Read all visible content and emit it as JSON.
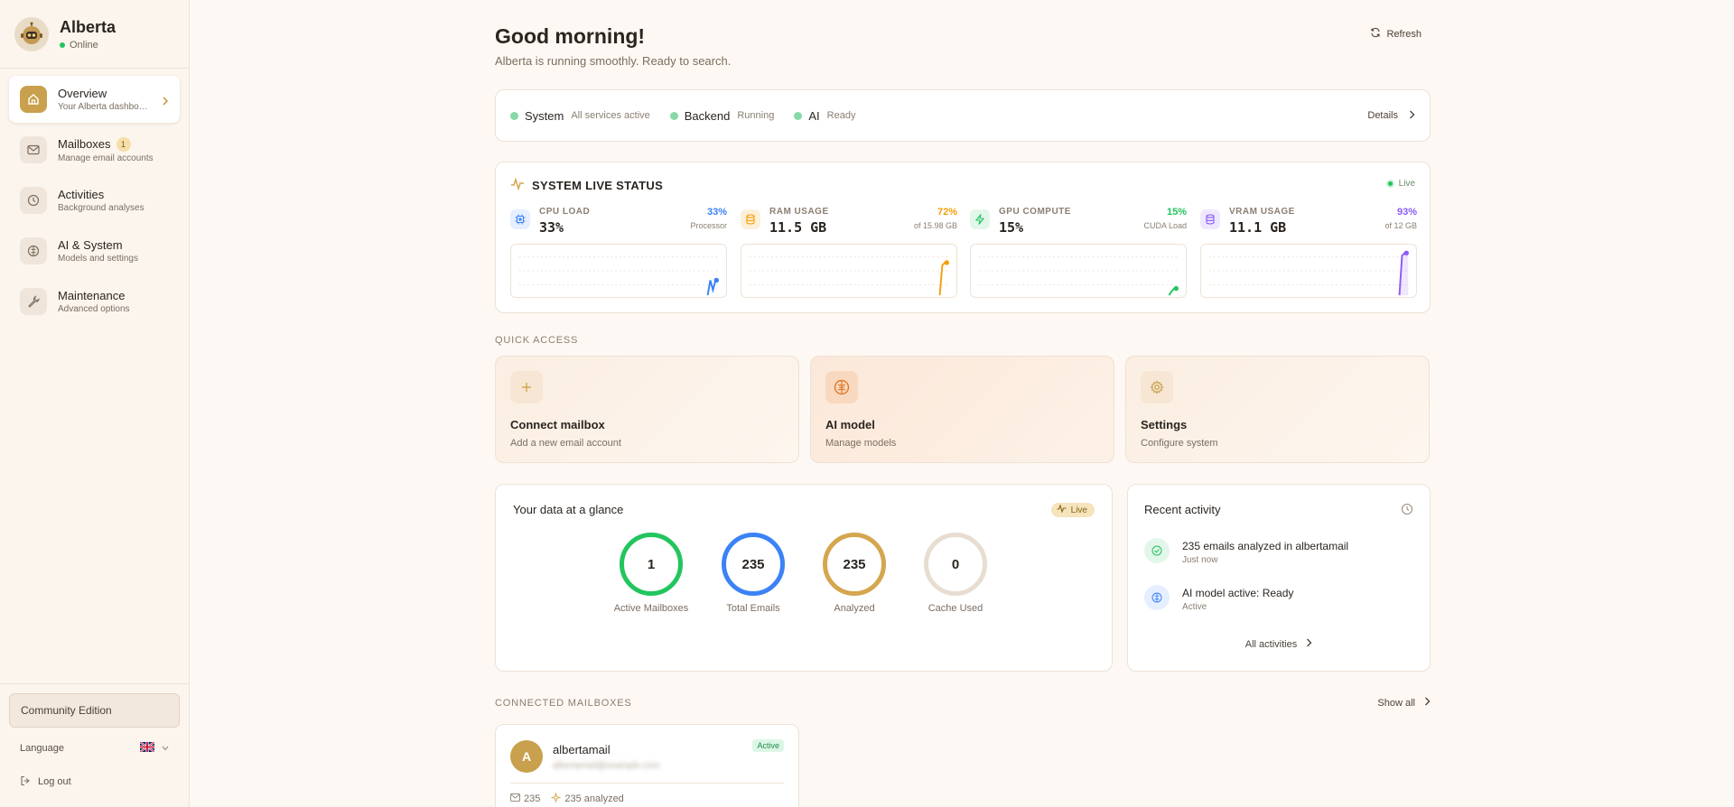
{
  "app": {
    "name": "Alberta",
    "status": "Online"
  },
  "sidebar": {
    "items": [
      {
        "label": "Overview",
        "sub": "Your Alberta dashboard",
        "icon": "home-icon"
      },
      {
        "label": "Mailboxes",
        "sub": "Manage email accounts",
        "icon": "mail-icon",
        "badge": "1"
      },
      {
        "label": "Activities",
        "sub": "Background analyses",
        "icon": "clock-icon"
      },
      {
        "label": "AI & System",
        "sub": "Models and settings",
        "icon": "brain-icon"
      },
      {
        "label": "Maintenance",
        "sub": "Advanced options",
        "icon": "wrench-icon"
      }
    ],
    "edition": "Community Edition",
    "language_label": "Language",
    "logout_label": "Log out"
  },
  "header": {
    "greeting": "Good morning!",
    "subtitle": "Alberta is running smoothly. Ready to search.",
    "refresh_label": "Refresh"
  },
  "status_bar": {
    "items": [
      {
        "name": "System",
        "value": "All services active"
      },
      {
        "name": "Backend",
        "value": "Running"
      },
      {
        "name": "AI",
        "value": "Ready"
      }
    ],
    "details_label": "Details"
  },
  "live_status": {
    "title": "SYSTEM LIVE STATUS",
    "live_label": "Live",
    "metrics": [
      {
        "name": "CPU LOAD",
        "value": "33%",
        "pct": "33%",
        "note": "Processor",
        "color": "#3b82f6",
        "icon_bg": "#e6efff",
        "level": 0.33
      },
      {
        "name": "RAM USAGE",
        "value": "11.5 GB",
        "pct": "72%",
        "note": "of 15.98 GB",
        "color": "#f59e0b",
        "icon_bg": "#fdf0d9",
        "level": 0.72
      },
      {
        "name": "GPU COMPUTE",
        "value": "15%",
        "pct": "15%",
        "note": "CUDA Load",
        "color": "#22c55e",
        "icon_bg": "#e2f7ea",
        "level": 0.15
      },
      {
        "name": "VRAM USAGE",
        "value": "11.1 GB",
        "pct": "93%",
        "note": "of 12 GB",
        "color": "#8b5cf6",
        "icon_bg": "#efe8fd",
        "level": 0.93
      }
    ]
  },
  "quick_access": {
    "label": "QUICK ACCESS",
    "items": [
      {
        "title": "Connect mailbox",
        "sub": "Add a new email account",
        "icon": "plus-icon"
      },
      {
        "title": "AI model",
        "sub": "Manage models",
        "icon": "brain-icon"
      },
      {
        "title": "Settings",
        "sub": "Configure system",
        "icon": "gear-icon"
      }
    ]
  },
  "glance": {
    "title": "Your data at a glance",
    "live_label": "Live",
    "stats": [
      {
        "value": "1",
        "label": "Active Mailboxes",
        "color": "#22c55e"
      },
      {
        "value": "235",
        "label": "Total Emails",
        "color": "#3b82f6"
      },
      {
        "value": "235",
        "label": "Analyzed",
        "color": "#d4a64f"
      },
      {
        "value": "0",
        "label": "Cache Used",
        "color": "#e7ddd0"
      }
    ]
  },
  "recent": {
    "title": "Recent activity",
    "items": [
      {
        "title": "235 emails analyzed in albertamail",
        "sub": "Just now"
      },
      {
        "title": "AI model active: Ready",
        "sub": "Active"
      }
    ],
    "all_label": "All activities"
  },
  "mailboxes": {
    "label": "CONNECTED MAILBOXES",
    "show_all_label": "Show all",
    "items": [
      {
        "initial": "A",
        "name": "albertamail",
        "email": "albertamail@example.com",
        "status": "Active",
        "emails": "235",
        "analyzed": "235 analyzed"
      }
    ]
  }
}
